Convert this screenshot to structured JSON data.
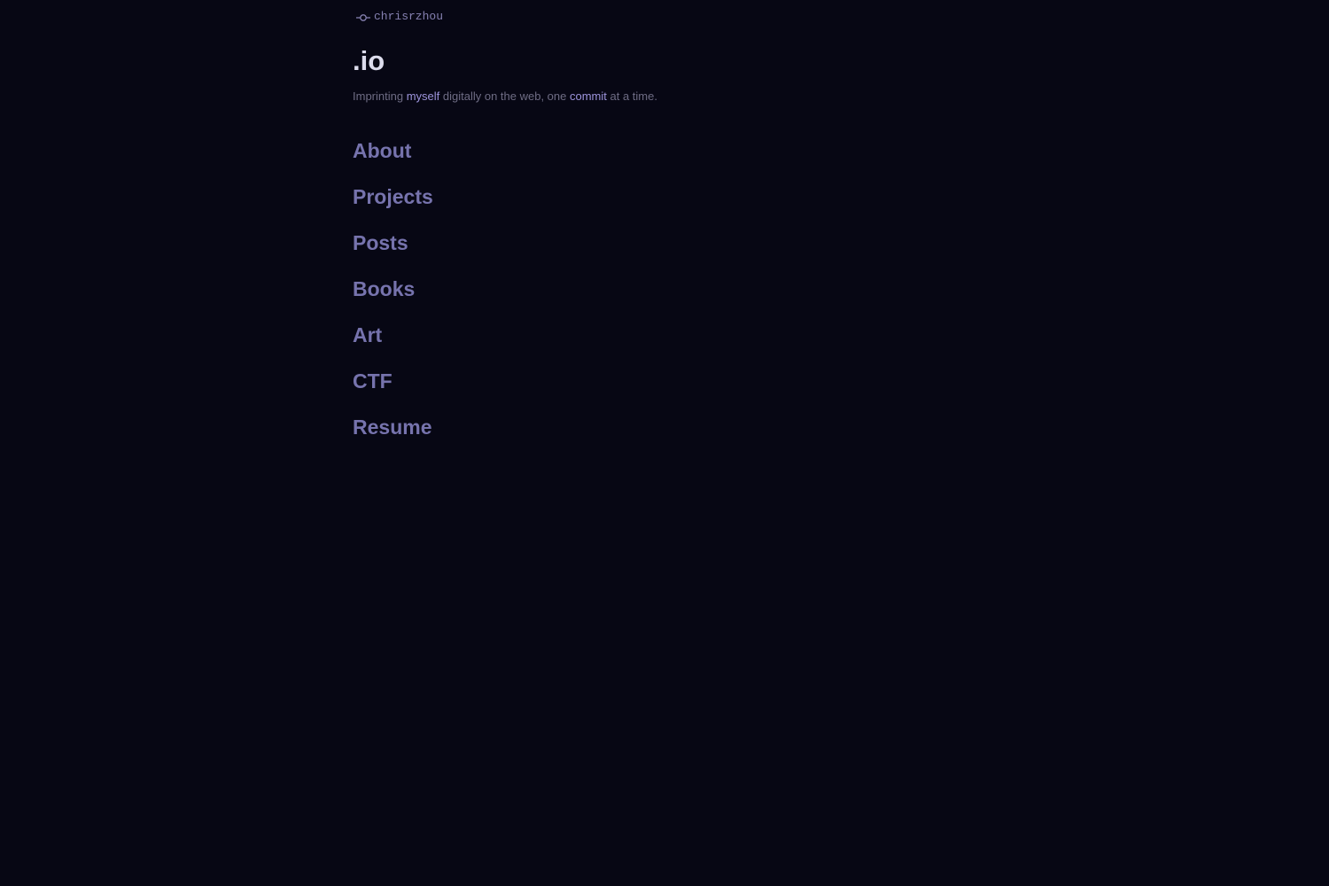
{
  "header": {
    "brand_label": "chrisrzhou",
    "brand_icon": "git-commit-icon",
    "title": ".io"
  },
  "tagline": {
    "part1": "Imprinting ",
    "link1": "myself",
    "part2": " digitally on the web, one ",
    "link2": "commit",
    "part3": " at a time."
  },
  "nav": {
    "items": [
      {
        "label": "About"
      },
      {
        "label": "Projects"
      },
      {
        "label": "Posts"
      },
      {
        "label": "Books"
      },
      {
        "label": "Art"
      },
      {
        "label": "CTF"
      },
      {
        "label": "Resume"
      }
    ]
  },
  "colors": {
    "background": "#070714",
    "accent": "#7673ad",
    "link": "#9d94dc",
    "title": "#dcdcec",
    "muted": "#6e6c84"
  }
}
